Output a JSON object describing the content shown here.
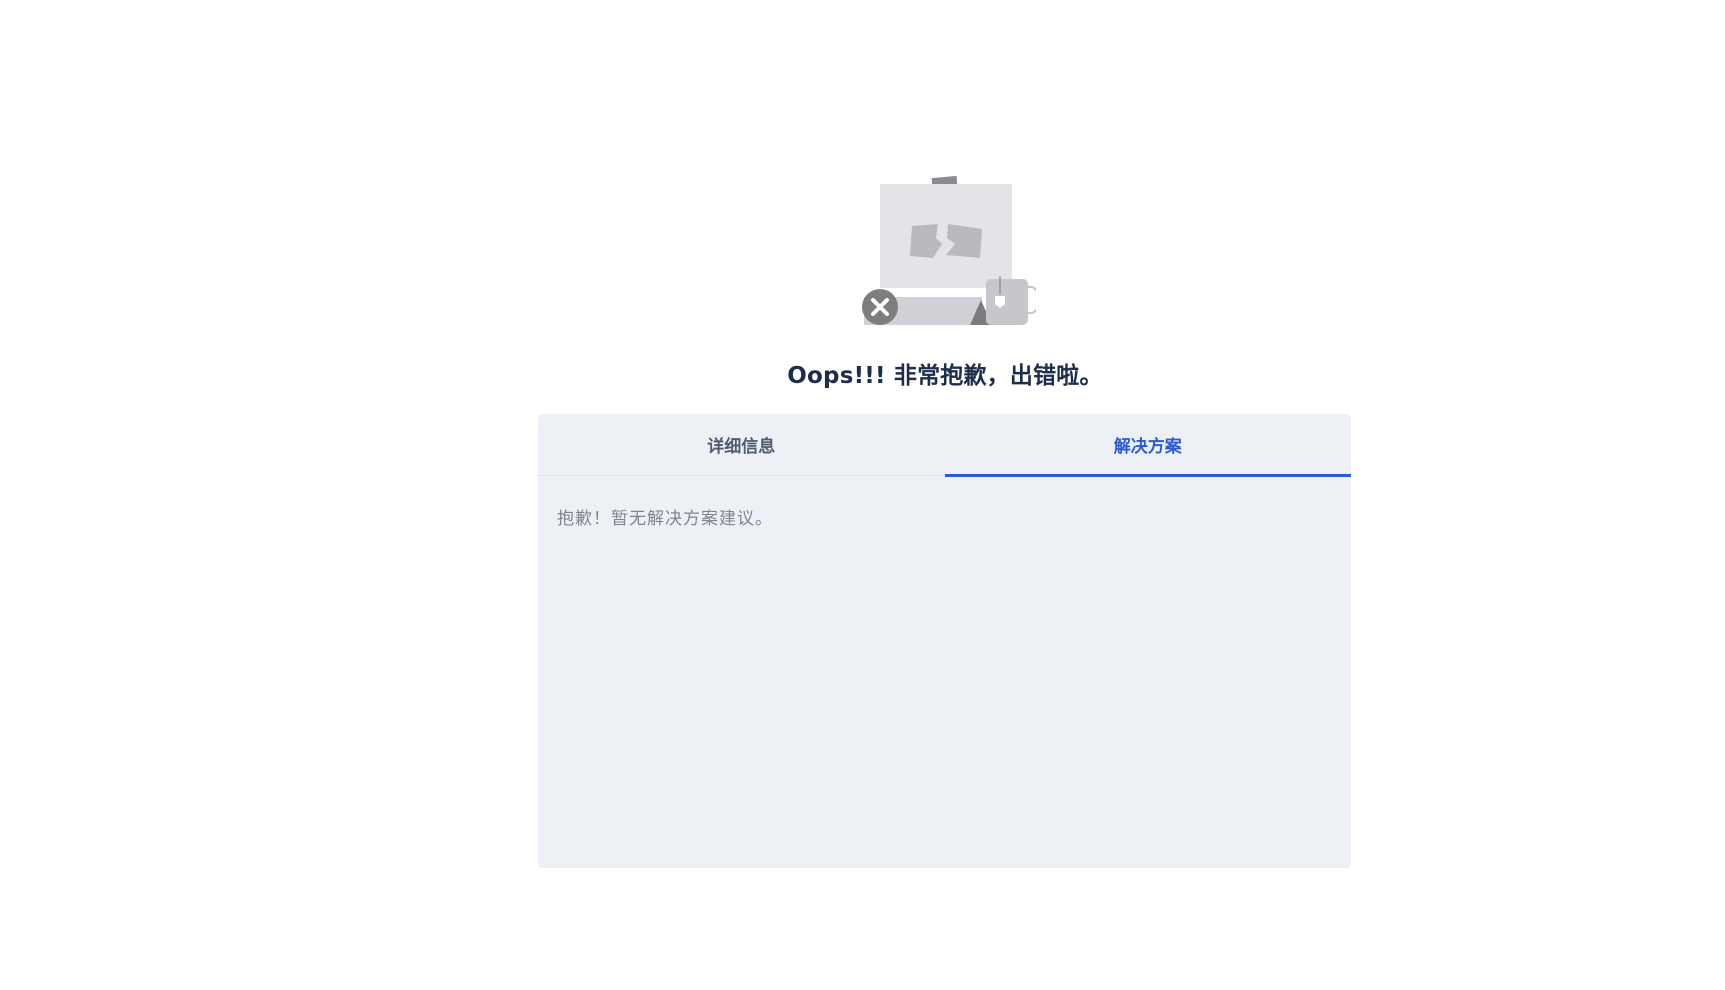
{
  "error": {
    "title": "Oops!!! 非常抱歉，出错啦。"
  },
  "tabs": [
    {
      "label": "详细信息",
      "active": false
    },
    {
      "label": "解决方案",
      "active": true
    }
  ],
  "panel": {
    "message": "抱歉！暂无解决方案建议。"
  },
  "colors": {
    "accent": "#2d5bd3",
    "title": "#1e2d4a",
    "panel_bg": "#edf0f5"
  },
  "icons": [
    "broken-document-icon",
    "error-x-icon",
    "tea-cup-icon"
  ]
}
